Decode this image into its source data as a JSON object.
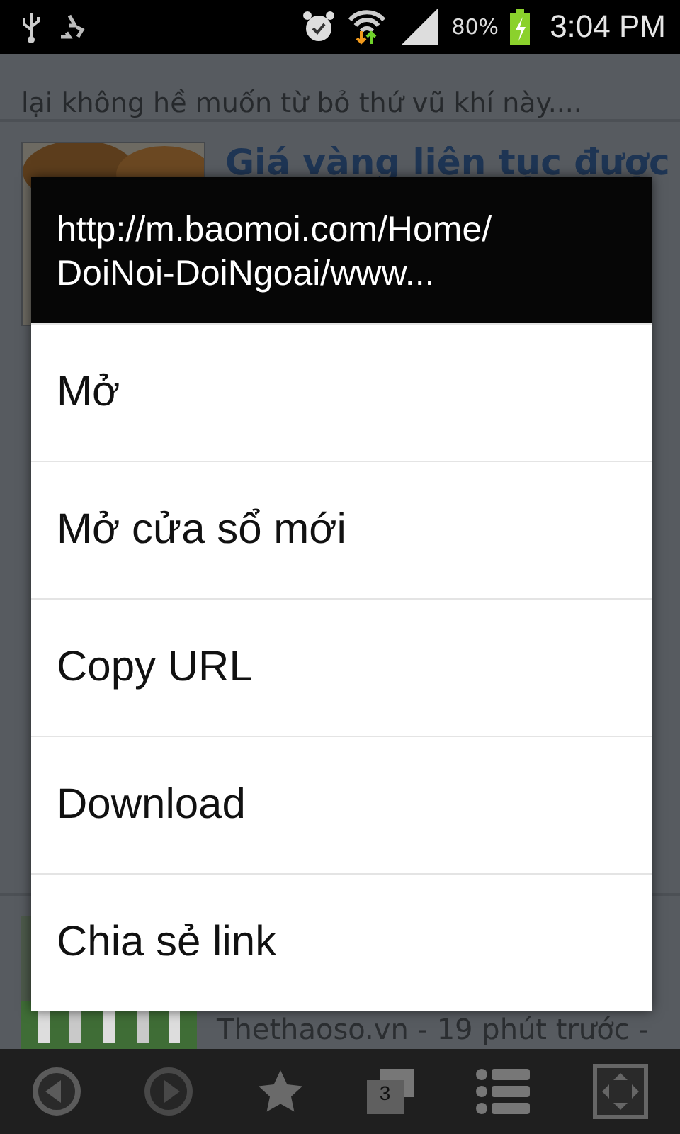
{
  "status_bar": {
    "battery": "80%",
    "time": "3:04 PM"
  },
  "background": {
    "snippet": "lại không hề muốn từ bỏ thứ vũ khí này....",
    "article_title": "Giá vàng liên tục được",
    "article_source": "Thethaoso.vn - 19 phút trước -"
  },
  "dialog": {
    "title": "http://m.baomoi.com/Home/\nDoiNoi-DoiNgoai/www...",
    "items": [
      {
        "label": "Mở"
      },
      {
        "label": "Mở cửa sổ mới"
      },
      {
        "label": "Copy URL"
      },
      {
        "label": "Download"
      },
      {
        "label": "Chia sẻ link"
      }
    ]
  },
  "toolbar": {
    "tab_count": "3"
  }
}
